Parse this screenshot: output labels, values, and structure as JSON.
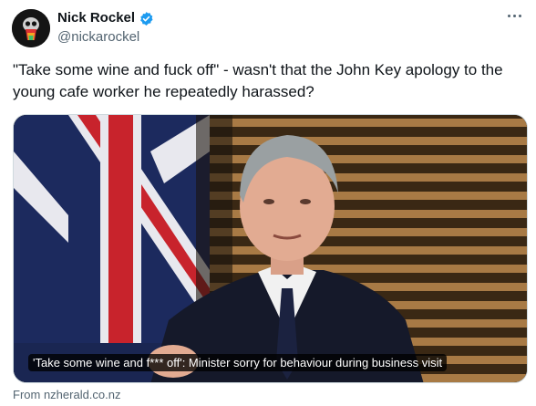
{
  "author": {
    "display_name": "Nick Rockel",
    "handle": "@nickarockel",
    "verified": true,
    "avatar_icon": "skull-avatar-icon"
  },
  "menu_icon": "more-options-icon",
  "tweet": {
    "text": "\"Take some wine and fuck off\" - wasn't that the John Key apology to the young cafe worker he repeatedly harassed?"
  },
  "link_card": {
    "caption": "'Take some wine and f*** off': Minister sorry for behaviour during business visit",
    "source": "From nzherald.co.nz"
  },
  "colors": {
    "verified_badge": "#1d9bf0",
    "text_primary": "#0f1419",
    "text_secondary": "#536471"
  }
}
